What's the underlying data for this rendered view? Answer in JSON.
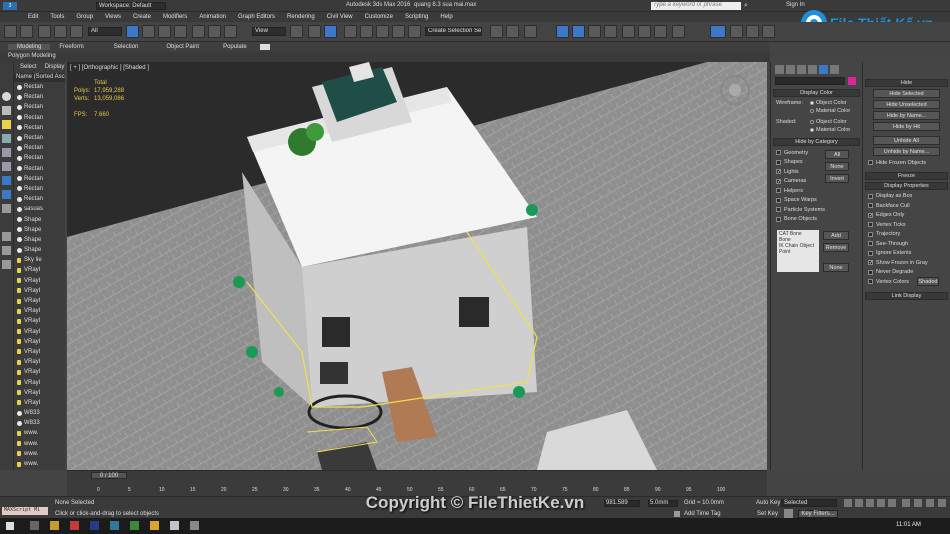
{
  "titlebar": {
    "workspace": "Workspace: Default",
    "app_title": "Autodesk 3ds Max 2016",
    "file_name": "quang 8.3 sua mai.max",
    "search_placeholder": "Type a keyword or phrase",
    "signin": "Sign In"
  },
  "menu": [
    "Edit",
    "Tools",
    "Group",
    "Views",
    "Create",
    "Modifiers",
    "Animation",
    "Graph Editors",
    "Rendering",
    "Civil View",
    "Customize",
    "Scripting",
    "Help"
  ],
  "toolbar": {
    "filter_select": "All",
    "view_select": "View",
    "selection_set": "Create Selection Se"
  },
  "ribbon": {
    "tabs": [
      "Modeling",
      "Freeform",
      "Selection",
      "Object Paint",
      "Populate"
    ],
    "sub": "Polygon Modeling"
  },
  "scene_explorer": {
    "tabs": [
      "Select",
      "Display"
    ],
    "header": "Name (Sorted Ascen",
    "items": [
      "Rectan",
      "Rectan",
      "Rectan",
      "Rectan",
      "Rectan",
      "Rectan",
      "Rectan",
      "Rectan",
      "Rectan",
      "Rectan",
      "Rectan",
      "Rectan",
      "sasuas",
      "Shape",
      "Shape",
      "Shape",
      "Shape",
      "Sky lie",
      "VRayI",
      "VRayI",
      "VRayI",
      "VRayI",
      "VRayI",
      "VRayI",
      "VRayI",
      "VRayI",
      "VRayI",
      "VRayI",
      "VRayI",
      "VRayI",
      "VRayI",
      "VRayI",
      "W833",
      "W833",
      "www.",
      "www.",
      "www.",
      "www.",
      "www.",
      "www."
    ]
  },
  "viewport": {
    "label": "[ + ] [Orthographic ] [Shaded ]",
    "stats_total": "Total",
    "polys_label": "Polys:",
    "polys_value": "17,959,288",
    "verts_label": "Verts:",
    "verts_value": "13,059,086",
    "fps_label": "FPS:",
    "fps_value": "7.660"
  },
  "display_panel": {
    "display_color": "Display Color",
    "wireframe_label": "Wireframe:",
    "shaded_label": "Shaded:",
    "object_color": "Object Color",
    "material_color": "Material Color",
    "hide_by_category": "Hide by Category",
    "categories": [
      "Geometry",
      "Shapes",
      "Lights",
      "Cameras",
      "Helpers",
      "Space Warps",
      "Particle Systems",
      "Bone Objects"
    ],
    "btn_all": "All",
    "btn_none": "None",
    "btn_invert": "Invert",
    "list_items": [
      "CAT Bone",
      "Bone",
      "IK Chain Object",
      "Point"
    ],
    "btn_add": "Add",
    "btn_remove": "Remove",
    "btn_none2": "None"
  },
  "hide_panel": {
    "hide": "Hide",
    "buttons": [
      "Hide Selected",
      "Hide Unselected",
      "Hide by Name...",
      "Hide by Hit",
      "Unhide All",
      "Unhide by Name..."
    ],
    "hide_frozen": "Hide Frozen Objects",
    "freeze": "Freeze",
    "display_properties": "Display Properties",
    "props": [
      "Display as Box",
      "Backface Cull",
      "Edges Only",
      "Vertex Ticks",
      "Trajectory",
      "See-Through",
      "Ignore Extents",
      "Show Frozen in Gray",
      "Never Degrade",
      "Vertex Colors"
    ],
    "shaded_btn": "Shaded",
    "link_display": "Link Display"
  },
  "timeline": {
    "frame": "0 / 100",
    "ticks": [
      "0",
      "5",
      "10",
      "15",
      "20",
      "25",
      "30",
      "35",
      "40",
      "45",
      "50",
      "55",
      "60",
      "65",
      "70",
      "75",
      "80",
      "85",
      "90",
      "95",
      "100"
    ]
  },
  "status": {
    "maxscript": "MAXScript Mi",
    "none_selected": "None Selected",
    "prompt": "Click or click-and-drag to select objects",
    "x_val": "981.589",
    "y_val": "5.0mm",
    "grid": "Grid = 10.0mm",
    "add_time_tag": "Add Time Tag",
    "auto_key": "Auto Key",
    "selected": "Selected",
    "set_key": "Set Key",
    "key_filters": "Key Filters...",
    "clock": "11:01 AM"
  },
  "watermark": "Copyright © FileThietKe.vn",
  "logo_text": "File Thiết Kế.vn",
  "colors": {
    "accent": "#3c78c8",
    "logo_blue": "#1f8fd6",
    "selection_yellow": "#f0e050"
  }
}
